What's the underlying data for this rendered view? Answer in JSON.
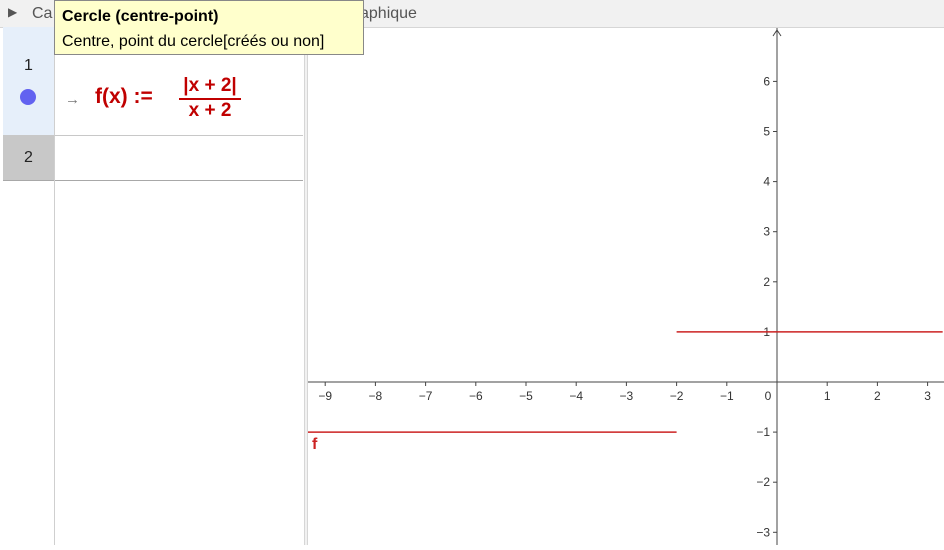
{
  "cas": {
    "toggle_icon": "triangle-right-icon",
    "title": "Ca",
    "rows": [
      {
        "number": "1",
        "previous_input": "(…) … (…) (…)",
        "arrow": "→",
        "lhs": "f(x) :=",
        "numerator": "|x + 2|",
        "denominator": "x + 2",
        "dot_color": "#6262f0"
      },
      {
        "number": "2"
      }
    ]
  },
  "graphics": {
    "title": "aphique",
    "function_label": "f",
    "function_color": "#cc2222",
    "x_ticks": [
      "−9",
      "−8",
      "−7",
      "−6",
      "−5",
      "−4",
      "−3",
      "−2",
      "−1",
      "0",
      "1",
      "2",
      "3"
    ],
    "y_ticks": [
      "6",
      "5",
      "4",
      "3",
      "2",
      "1",
      "−1",
      "−2",
      "−3"
    ]
  },
  "tooltip": {
    "title": "Cercle (centre-point)",
    "description": "Centre, point du cercle[créés ou non]"
  },
  "chart_data": {
    "type": "line",
    "title": "",
    "xlabel": "",
    "ylabel": "",
    "xlim": [
      -9.4,
      3.3
    ],
    "ylim": [
      -3.2,
      7
    ],
    "grid": false,
    "series": [
      {
        "name": "f",
        "segments": [
          {
            "x": [
              -9.4,
              -2
            ],
            "y": [
              -1,
              -1
            ]
          },
          {
            "x": [
              -2,
              3.3
            ],
            "y": [
              1,
              1
            ]
          }
        ]
      }
    ]
  }
}
